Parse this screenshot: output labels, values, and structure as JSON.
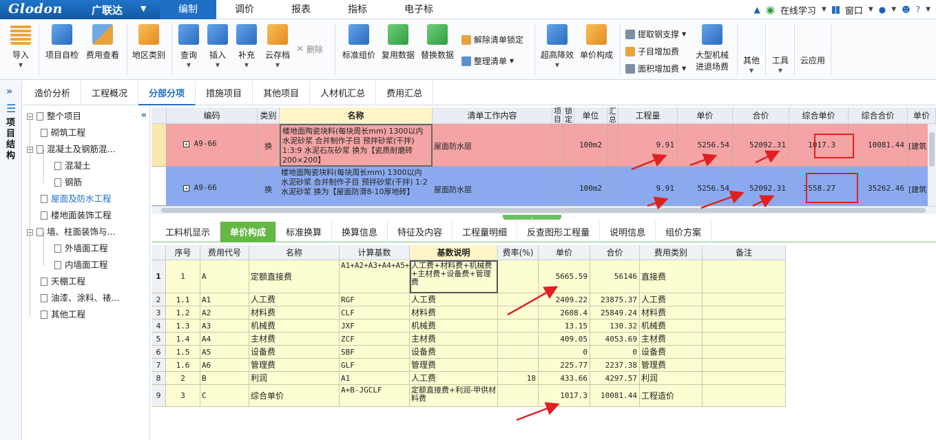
{
  "app": {
    "logo": "Glodon",
    "logo_cn": "广联达",
    "menu": [
      "编制",
      "调价",
      "报表",
      "指标",
      "电子标"
    ],
    "right": {
      "online": "在线学习",
      "window": "窗口",
      "help": "?"
    }
  },
  "ribbon": {
    "import": "导入",
    "self_check": "项目自检",
    "fee_view": "费用查看",
    "region": "地区类别",
    "query": "查询",
    "insert": "插入",
    "supplement": "补充",
    "cloud_save": "云存档",
    "delete": "删除",
    "std_price": "标准组价",
    "reuse": "复用数据",
    "replace": "替换数据",
    "unlock": "解除清单锁定",
    "organize": "整理清单",
    "super_height": "超高降效",
    "unit_comp": "单价构成",
    "rebar": "提取钢支撑",
    "sub_add": "子目增加费",
    "area_add": "面积增加费",
    "machine_line1": "大型机械",
    "machine_line2": "进退场费",
    "other": "其他",
    "tools": "工具",
    "cloud_app": "云应用"
  },
  "sidebar": {
    "title": "项目结构"
  },
  "page_tabs": [
    "造价分析",
    "工程概况",
    "分部分项",
    "措施项目",
    "其他项目",
    "人材机汇总",
    "费用汇总"
  ],
  "tree": {
    "root": "整个项目",
    "items": [
      "砌筑工程",
      "混凝土及钢筋混...",
      "混凝土",
      "钢筋",
      "屋面及防水工程",
      "楼地面装饰工程",
      "墙、柱面装饰与...",
      "外墙面工程",
      "内墙面工程",
      "天棚工程",
      "油漆、涂料、裱...",
      "其他工程"
    ]
  },
  "upper_grid": {
    "headers": [
      "编码",
      "类别",
      "名称",
      "清单工作内容",
      "项目",
      "锁定",
      "单位",
      "汇总",
      "工程量",
      "单价",
      "合价",
      "综合单价",
      "综合合价",
      "单价"
    ],
    "rows": [
      {
        "code": "A9-66",
        "type": "换",
        "name": "楼地面陶瓷块料(每块周长mm) 1300以内 水泥砂浆 合并制作子目 预拌砂浆(干拌) 1:3:9 水泥石灰砂浆 换为【瓷质耐磨砖200×200】",
        "work": "屋面防水层",
        "unit": "100m2",
        "qty": "9.91",
        "price": "5256.54",
        "total": "52092.31",
        "comp_price": "1017.3",
        "comp_total": "10081.44",
        "extra": "[建筑"
      },
      {
        "code": "A9-66",
        "type": "换",
        "name": "楼地面陶瓷块料(每块周长mm) 1300以内 水泥砂浆 合并制作子目 预拌砂浆(干拌) 1:2 水泥砂浆 换为【屋面防滑8-10厚地砖】",
        "work": "屋面防水层",
        "unit": "100m2",
        "qty": "9.91",
        "price": "5256.54",
        "total": "52092.31",
        "comp_price": "3558.27",
        "comp_total": "35262.46",
        "extra": "[建筑"
      }
    ]
  },
  "lower_tabs": [
    "工料机显示",
    "单价构成",
    "标准换算",
    "换算信息",
    "特征及内容",
    "工程量明细",
    "反查图形工程量",
    "说明信息",
    "组价方案"
  ],
  "lower_grid": {
    "headers": [
      "序号",
      "费用代号",
      "名称",
      "计算基数",
      "基数说明",
      "费率(%)",
      "单价",
      "合价",
      "费用类别",
      "备注"
    ],
    "rows": [
      {
        "n": "1",
        "seq": "1",
        "code": "A",
        "name": "定额直接费",
        "base": "A1+A2+A3+A4+A5+A6",
        "desc": "人工费+材料费+机械费+主材费+设备费+管理费",
        "rate": "",
        "price": "5665.59",
        "total": "56146",
        "cat": "直接费"
      },
      {
        "n": "2",
        "seq": "1.1",
        "code": "A1",
        "name": "人工费",
        "base": "RGF",
        "desc": "人工费",
        "rate": "",
        "price": "2409.22",
        "total": "23875.37",
        "cat": "人工费"
      },
      {
        "n": "3",
        "seq": "1.2",
        "code": "A2",
        "name": "材料费",
        "base": "CLF",
        "desc": "材料费",
        "rate": "",
        "price": "2608.4",
        "total": "25849.24",
        "cat": "材料费"
      },
      {
        "n": "4",
        "seq": "1.3",
        "code": "A3",
        "name": "机械费",
        "base": "JXF",
        "desc": "机械费",
        "rate": "",
        "price": "13.15",
        "total": "130.32",
        "cat": "机械费"
      },
      {
        "n": "5",
        "seq": "1.4",
        "code": "A4",
        "name": "主材费",
        "base": "ZCF",
        "desc": "主材费",
        "rate": "",
        "price": "409.05",
        "total": "4053.69",
        "cat": "主材费"
      },
      {
        "n": "6",
        "seq": "1.5",
        "code": "A5",
        "name": "设备费",
        "base": "SBF",
        "desc": "设备费",
        "rate": "",
        "price": "0",
        "total": "0",
        "cat": "设备费"
      },
      {
        "n": "7",
        "seq": "1.6",
        "code": "A6",
        "name": "管理费",
        "base": "GLF",
        "desc": "管理费",
        "rate": "",
        "price": "225.77",
        "total": "2237.38",
        "cat": "管理费"
      },
      {
        "n": "8",
        "seq": "2",
        "code": "B",
        "name": "利润",
        "base": "A1",
        "desc": "人工费",
        "rate": "18",
        "price": "433.66",
        "total": "4297.57",
        "cat": "利润"
      },
      {
        "n": "9",
        "seq": "3",
        "code": "C",
        "name": "综合单价",
        "base": "A+B-JGCLF",
        "desc": "定额直接费+利润-甲供材料费",
        "rate": "",
        "price": "1017.3",
        "total": "10081.44",
        "cat": "工程造价"
      }
    ]
  },
  "colors": {
    "brand": "#1f6fc7",
    "row_red": "#f4a4a4",
    "row_blue": "#8aa9ee",
    "tab_green": "#66b845",
    "cell_yellow": "#fdfdd2",
    "annotation": "#e02020"
  }
}
